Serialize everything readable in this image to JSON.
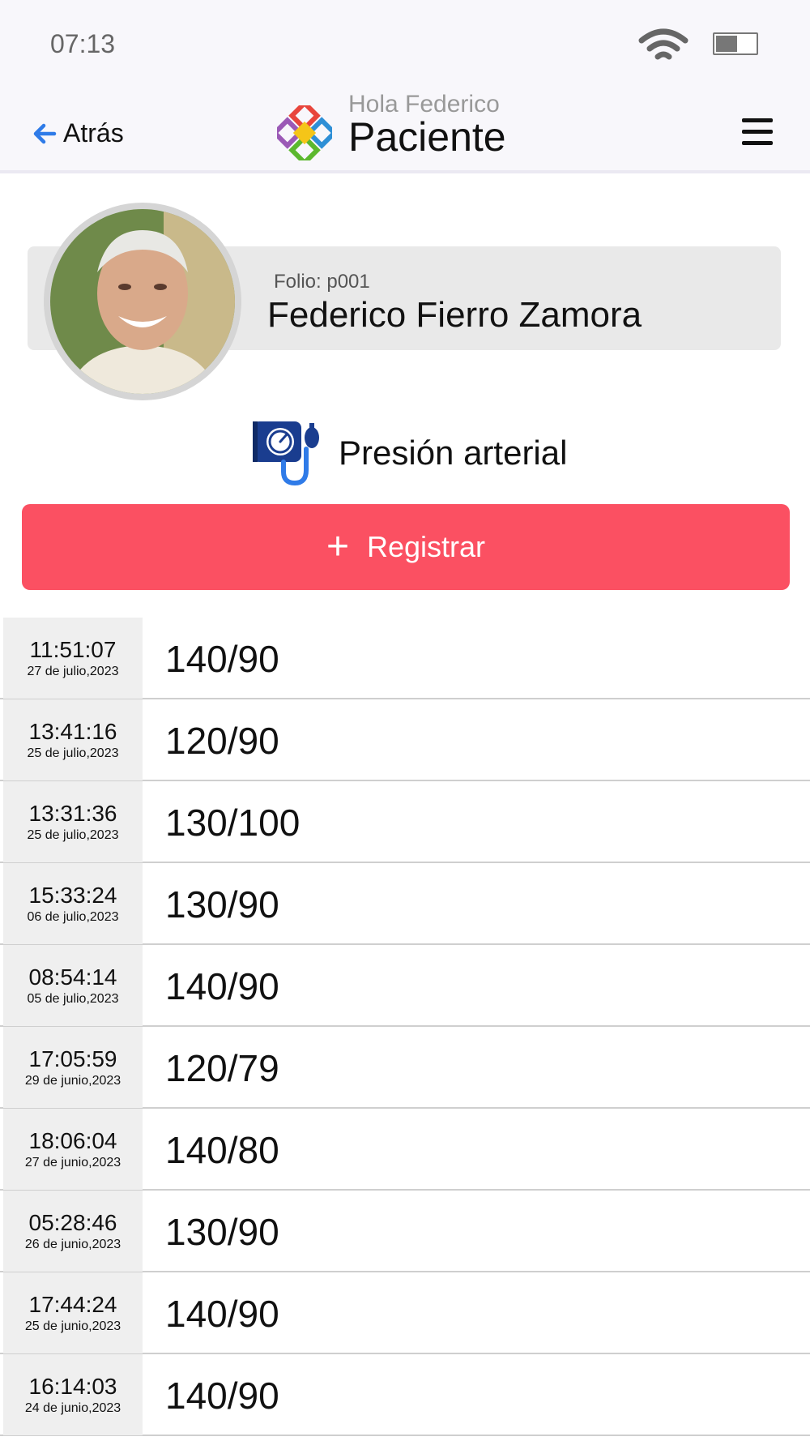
{
  "status_bar": {
    "time": "07:13",
    "wifi_icon": "wifi-icon",
    "battery_icon": "battery-icon",
    "battery_level": 0.55
  },
  "header": {
    "back_label": "Atrás",
    "greeting": "Hola Federico",
    "title": "Paciente",
    "logo_icon": "app-logo",
    "menu_icon": "hamburger-menu-icon"
  },
  "patient": {
    "folio": "Folio: p001",
    "name": "Federico Fierro Zamora",
    "avatar": "patient-photo"
  },
  "section": {
    "title": "Presión arterial",
    "icon": "blood-pressure-monitor-icon"
  },
  "register_button": {
    "icon": "+",
    "label": "Registrar"
  },
  "colors": {
    "accent": "#fb5062",
    "icon_blue": "#1a3d8f",
    "icon_light_blue": "#2f7be8",
    "back_arrow": "#2f7be8"
  },
  "records": [
    {
      "time": "11:51:07",
      "date": "27 de julio,2023",
      "value": "140/90"
    },
    {
      "time": "13:41:16",
      "date": "25 de julio,2023",
      "value": "120/90"
    },
    {
      "time": "13:31:36",
      "date": "25 de julio,2023",
      "value": "130/100"
    },
    {
      "time": "15:33:24",
      "date": "06 de julio,2023",
      "value": "130/90"
    },
    {
      "time": "08:54:14",
      "date": "05 de julio,2023",
      "value": "140/90"
    },
    {
      "time": "17:05:59",
      "date": "29 de junio,2023",
      "value": "120/79"
    },
    {
      "time": "18:06:04",
      "date": "27 de junio,2023",
      "value": "140/80"
    },
    {
      "time": "05:28:46",
      "date": "26 de junio,2023",
      "value": "130/90"
    },
    {
      "time": "17:44:24",
      "date": "25 de junio,2023",
      "value": "140/90"
    },
    {
      "time": "16:14:03",
      "date": "24 de junio,2023",
      "value": "140/90"
    }
  ]
}
